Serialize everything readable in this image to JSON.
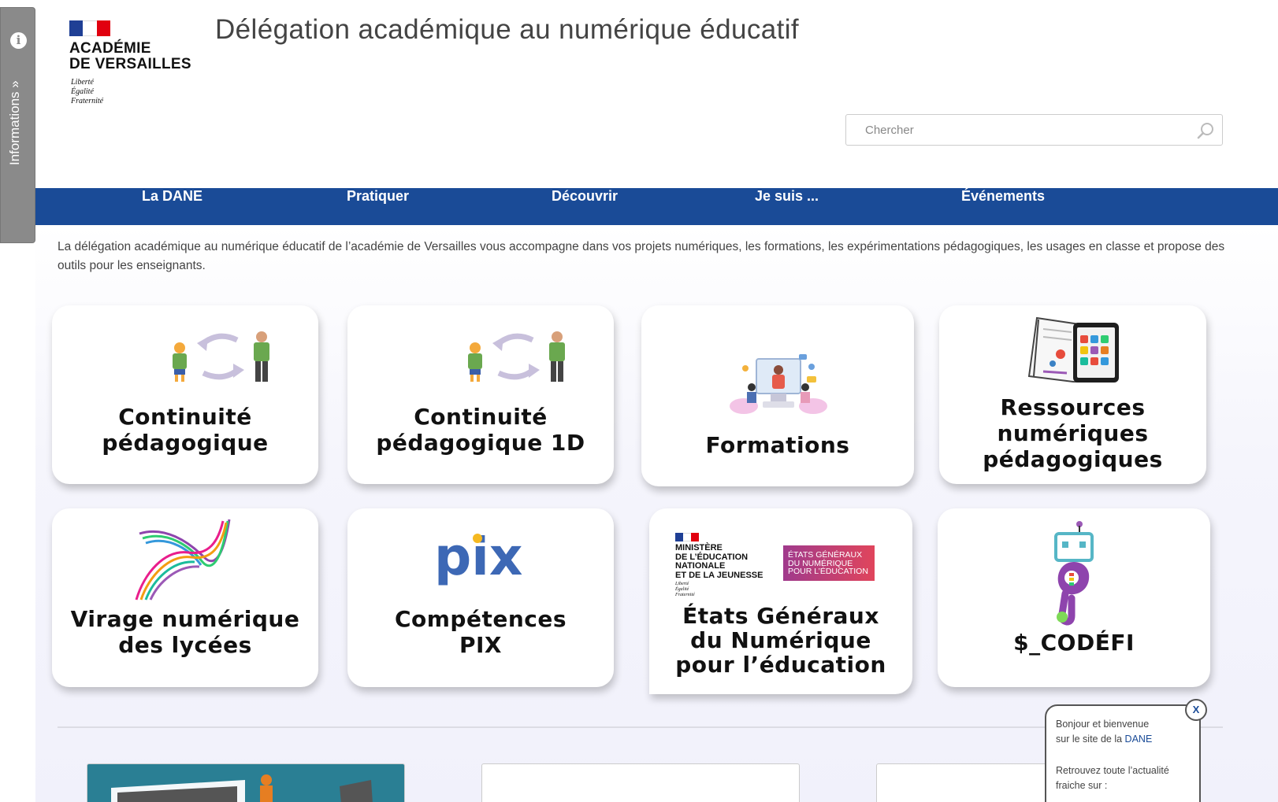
{
  "sidebar": {
    "info_label": "Informations"
  },
  "logo": {
    "institution_line1": "ACADÉMIE",
    "institution_line2": "DE VERSAILLES",
    "motto": [
      "Liberté",
      "Égalité",
      "Fraternité"
    ]
  },
  "header": {
    "title": "Délégation académique au numérique éducatif"
  },
  "search": {
    "placeholder": "Chercher"
  },
  "nav": {
    "items": [
      {
        "label": "La DANE"
      },
      {
        "label": "Pratiquer"
      },
      {
        "label": "Découvrir"
      },
      {
        "label": "Je suis ..."
      },
      {
        "label": "Événements"
      }
    ]
  },
  "intro": {
    "text": "La délégation académique au numérique éducatif de l’académie de Versailles vous accompagne dans vos projets numériques, les formations, les expérimentations pédagogiques, les usages en classe et propose des outils pour les enseignants."
  },
  "cards": [
    {
      "line1": "Continuité",
      "line2": "pédagogique",
      "icon": "student-teacher-exchange-icon"
    },
    {
      "line1": "Continuité",
      "line2": "pédagogique 1D",
      "icon": "student-teacher-exchange-icon"
    },
    {
      "line1": "Formations",
      "icon": "online-training-illustration"
    },
    {
      "line1": "Ressources",
      "line2": "numériques",
      "line3": "pédagogiques",
      "icon": "book-tablet-icon"
    },
    {
      "line1": "Virage numérique",
      "line2": "des lycées",
      "icon": "colorful-waves-icon"
    },
    {
      "line1": "Compétences",
      "line2": "PIX",
      "icon": "pix-logo",
      "logo_text": "pix"
    },
    {
      "line1": "États Généraux",
      "line2": "du Numérique",
      "line3": "pour l’éducation",
      "icon": "ministry-logo",
      "ministry_lines": [
        "MINISTÈRE",
        "DE L’ÉDUCATION",
        "NATIONALE",
        "ET DE LA JEUNESSE"
      ],
      "ministry_motto": [
        "Liberté",
        "Égalité",
        "Fraternité"
      ],
      "badge_lines": [
        "ÉTATS GÉNÉRAUX",
        "DU NUMÉRIQUE",
        "POUR L’ÉDUCATION"
      ]
    },
    {
      "line1": "$_CODÉFI",
      "icon": "codefi-robot-icon"
    }
  ],
  "chat": {
    "line1": "Bonjour et bienvenue",
    "line2_prefix": "sur le site de la ",
    "line2_link": "DANE",
    "line3": "Retrouvez toute l’actualité",
    "line4": "fraiche sur :",
    "close_label": "X"
  },
  "colors": {
    "nav_bg": "#1a4b97",
    "accent": "#1a4b97",
    "pix_blue": "#3d68b5",
    "pix_purple": "#9b6fd0"
  }
}
